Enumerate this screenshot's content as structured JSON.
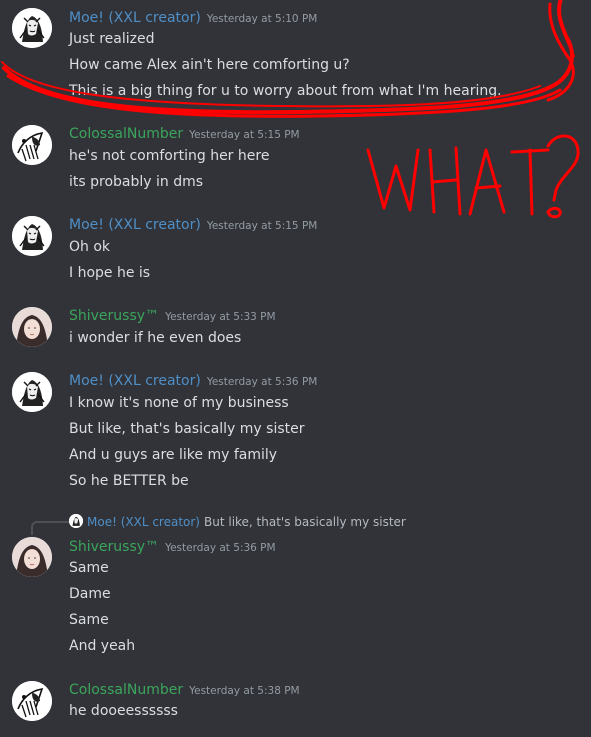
{
  "colors": {
    "background": "#313338",
    "text": "#dbdee1",
    "timestamp": "#949ba4",
    "moe": "#4f8fc7",
    "colossal": "#3ba55c",
    "shiver": "#3ba55c",
    "annotation": "#ff0000"
  },
  "messages": [
    {
      "author": "Moe! (XXL creator)",
      "timestamp": "Yesterday at 5:10 PM",
      "lines": [
        "Just realized",
        "How came Alex ain't here comforting u?",
        "This is a big thing for u to worry about from what I'm hearing."
      ]
    },
    {
      "author": "ColossalNumber",
      "timestamp": "Yesterday at 5:15 PM",
      "lines": [
        "he's not comforting her here",
        "its probably in dms"
      ]
    },
    {
      "author": "Moe! (XXL creator)",
      "timestamp": "Yesterday at 5:15 PM",
      "lines": [
        "Oh ok",
        "I hope he is"
      ]
    },
    {
      "author": "Shiverussy™",
      "timestamp": "Yesterday at 5:33 PM",
      "lines": [
        "i wonder if he even does"
      ]
    },
    {
      "author": "Moe! (XXL creator)",
      "timestamp": "Yesterday at 5:36 PM",
      "lines": [
        "I know it's none of my business",
        "But like, that's basically my sister",
        "And u guys are like my family",
        "So he BETTER be"
      ]
    },
    {
      "reply": {
        "author": "Moe! (XXL creator)",
        "text": "But like, that's basically my sister"
      },
      "author": "Shiverussy™",
      "timestamp": "Yesterday at 5:36 PM",
      "lines": [
        "Same",
        "Dame",
        "Same",
        "And yeah"
      ]
    },
    {
      "author": "ColossalNumber",
      "timestamp": "Yesterday at 5:38 PM",
      "lines": [
        "he dooeessssss"
      ]
    }
  ]
}
